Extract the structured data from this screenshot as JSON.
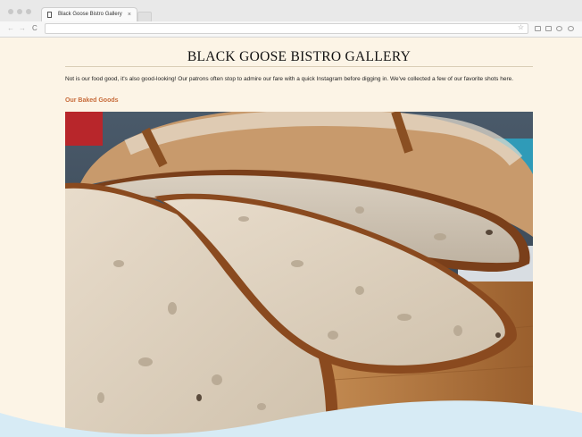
{
  "browser": {
    "tab_title": "Black Goose Bistro Gallery",
    "tab_close": "×",
    "back": "←",
    "forward": "→",
    "reload": "C",
    "bookmark": "☆"
  },
  "page": {
    "title": "BLACK GOOSE BISTRO GALLERY",
    "intro": "Not is our food good, it's also good-looking! Our patrons often stop to admire our fare with a quick Instagram before digging in. We've collected a few of our favorite shots here.",
    "section_heading": "Our Baked Goods"
  },
  "colors": {
    "page_background": "#fcf4e6",
    "heading_accent": "#c76b3a",
    "outer_background": "#d7ebf5"
  }
}
